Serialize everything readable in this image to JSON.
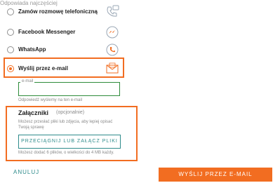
{
  "top_cut_text": "Odpowiada najczęściej",
  "options": [
    {
      "label": "Zamów rozmowę telefoniczną",
      "icon": "phone-chat-icon",
      "selected": false
    },
    {
      "label": "Facebook Messenger",
      "icon": "messenger-icon",
      "selected": false
    },
    {
      "label": "WhatsApp",
      "icon": "whatsapp-icon",
      "selected": false
    },
    {
      "label": "Wyślij przez e-mail",
      "icon": "email-icon",
      "selected": true
    }
  ],
  "email": {
    "legend": "e-mail",
    "value": "",
    "helper": "Odpowiedź wyślemy na ten e-mail"
  },
  "attachments": {
    "title": "Załączniki",
    "optional": "(opcjonalnie)",
    "description": "Możesz przesłać pliki lub zdjęcia, aby lepiej opisać Twoją sprawę",
    "upload_label": "PRZECIĄGNIJ LUB ZAŁĄCZ PLIKI",
    "limit": "Możesz dodać 6 plików, o wielkości do 4 MB każdy."
  },
  "actions": {
    "cancel": "ANULUJ",
    "send": "WYŚLIJ PRZEZ E-MAIL"
  },
  "colors": {
    "accent": "#f26d21",
    "teal": "#2e8b8b",
    "field_border": "#2e8b3a"
  }
}
